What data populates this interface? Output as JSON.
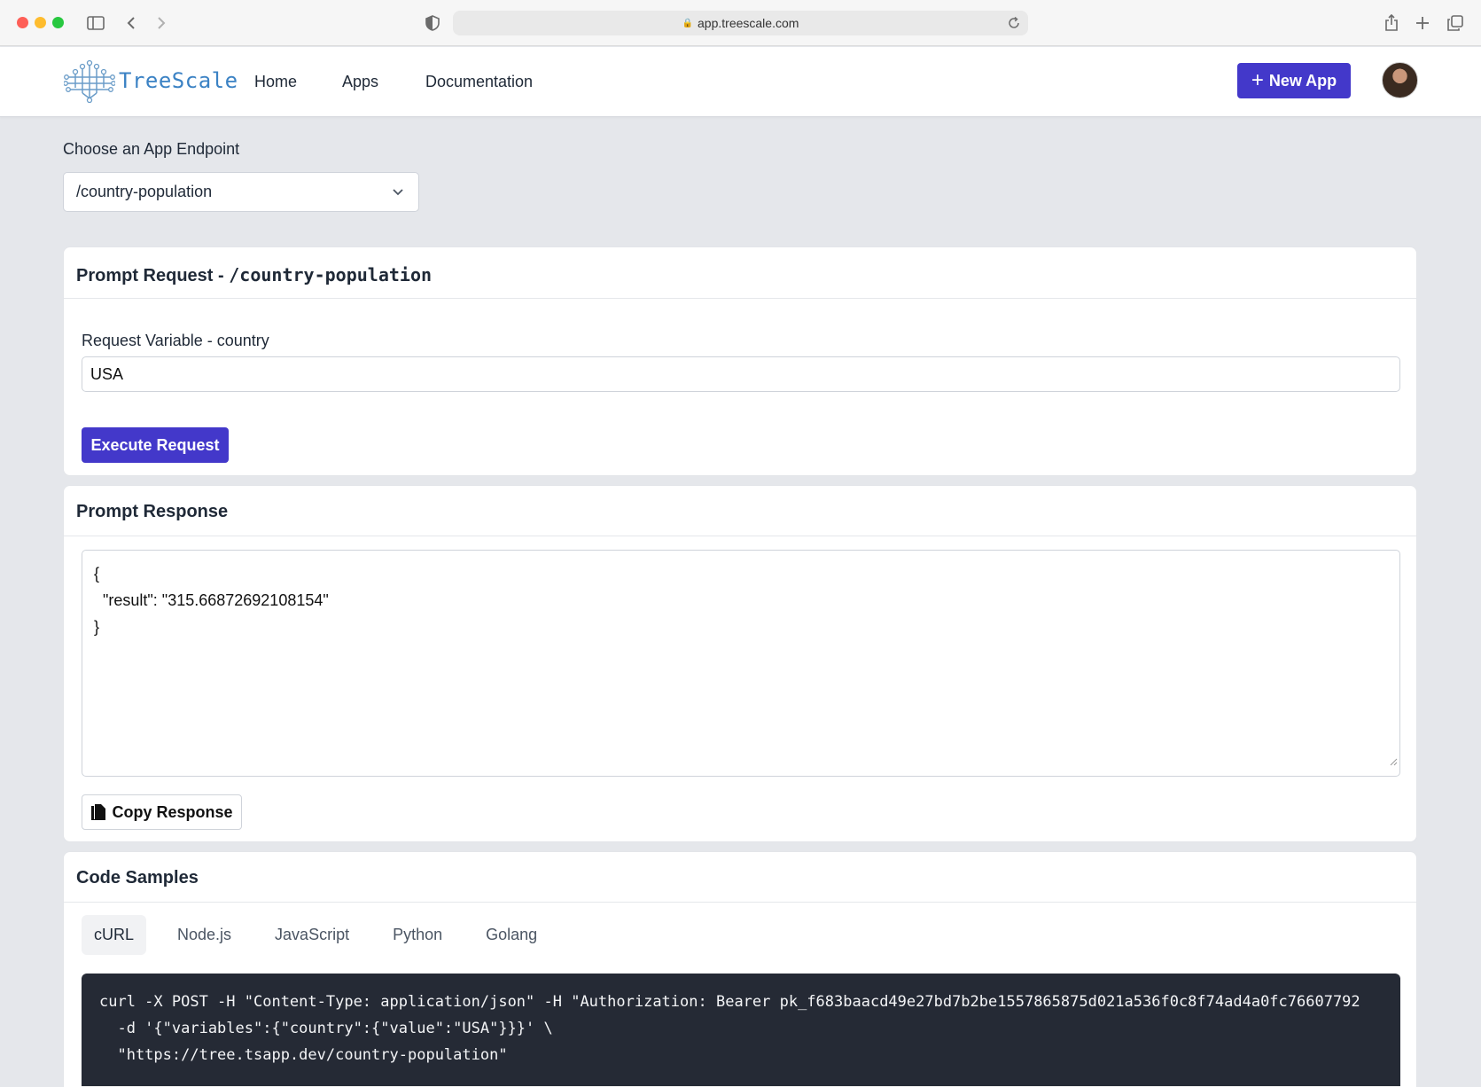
{
  "browser": {
    "url": "app.treescale.com"
  },
  "header": {
    "logo_text": "TreeScale",
    "nav": [
      {
        "label": "Home"
      },
      {
        "label": "Apps"
      },
      {
        "label": "Documentation"
      }
    ],
    "new_app_label": "New App"
  },
  "endpoint": {
    "label": "Choose an App Endpoint",
    "selected": "/country-population"
  },
  "request_card": {
    "title_prefix": "Prompt Request - ",
    "title_endpoint": "/country-population",
    "variable_label": "Request Variable - country",
    "variable_value": "USA",
    "execute_label": "Execute Request"
  },
  "response_card": {
    "title": "Prompt Response",
    "response_text": "{\n  \"result\": \"315.66872692108154\"\n}",
    "copy_label": "Copy Response"
  },
  "code_card": {
    "title": "Code Samples",
    "tabs": [
      {
        "label": "cURL",
        "active": true
      },
      {
        "label": "Node.js",
        "active": false
      },
      {
        "label": "JavaScript",
        "active": false
      },
      {
        "label": "Python",
        "active": false
      },
      {
        "label": "Golang",
        "active": false
      }
    ],
    "code": "curl -X POST -H \"Content-Type: application/json\" -H \"Authorization: Bearer pk_f683baacd49e27bd7b2be1557865875d021a536f0c8f74ad4a0fc76607792\n  -d '{\"variables\":{\"country\":{\"value\":\"USA\"}}}' \\\n  \"https://tree.tsapp.dev/country-population\""
  },
  "colors": {
    "primary": "#4338ca",
    "page_bg": "#e5e7eb",
    "code_bg": "#252a35"
  }
}
